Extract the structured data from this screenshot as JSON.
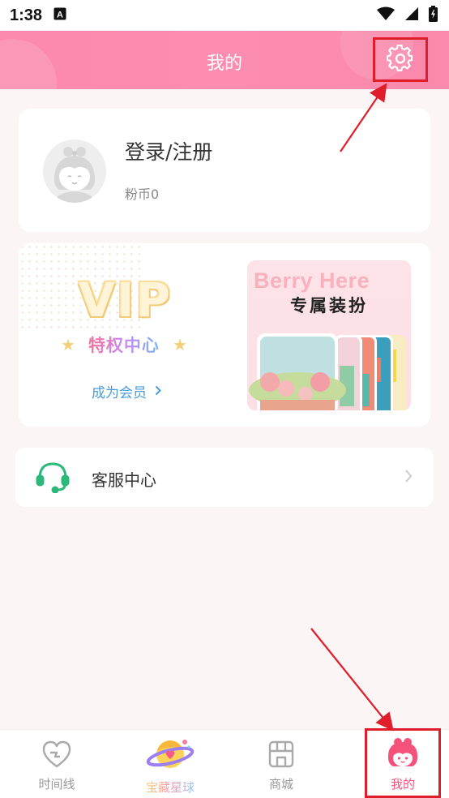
{
  "status_bar": {
    "time": "1:38",
    "notification": "A"
  },
  "header": {
    "title": "我的"
  },
  "profile": {
    "login_label": "登录/注册",
    "coin_label": "粉币0"
  },
  "vip": {
    "title": "VIP",
    "subtitle": "特权中心",
    "link_label": "成为会员",
    "promo_title_en": "Berry Here",
    "promo_title_cn": "专属装扮"
  },
  "service": {
    "label": "客服中心"
  },
  "tabbar": {
    "items": [
      {
        "label": "时间线",
        "icon": "heart-timeline-icon"
      },
      {
        "label": "宝藏星球",
        "icon": "planet-icon"
      },
      {
        "label": "商城",
        "icon": "shop-icon"
      },
      {
        "label": "我的",
        "icon": "girl-avatar-icon"
      }
    ],
    "active_color": "#f5527b",
    "inactive_color": "#999999"
  },
  "colors": {
    "header_pink": "#fd8db0",
    "highlight_red": "#e01d2a",
    "link_blue": "#4a9ddb",
    "service_green": "#2cb87a"
  }
}
